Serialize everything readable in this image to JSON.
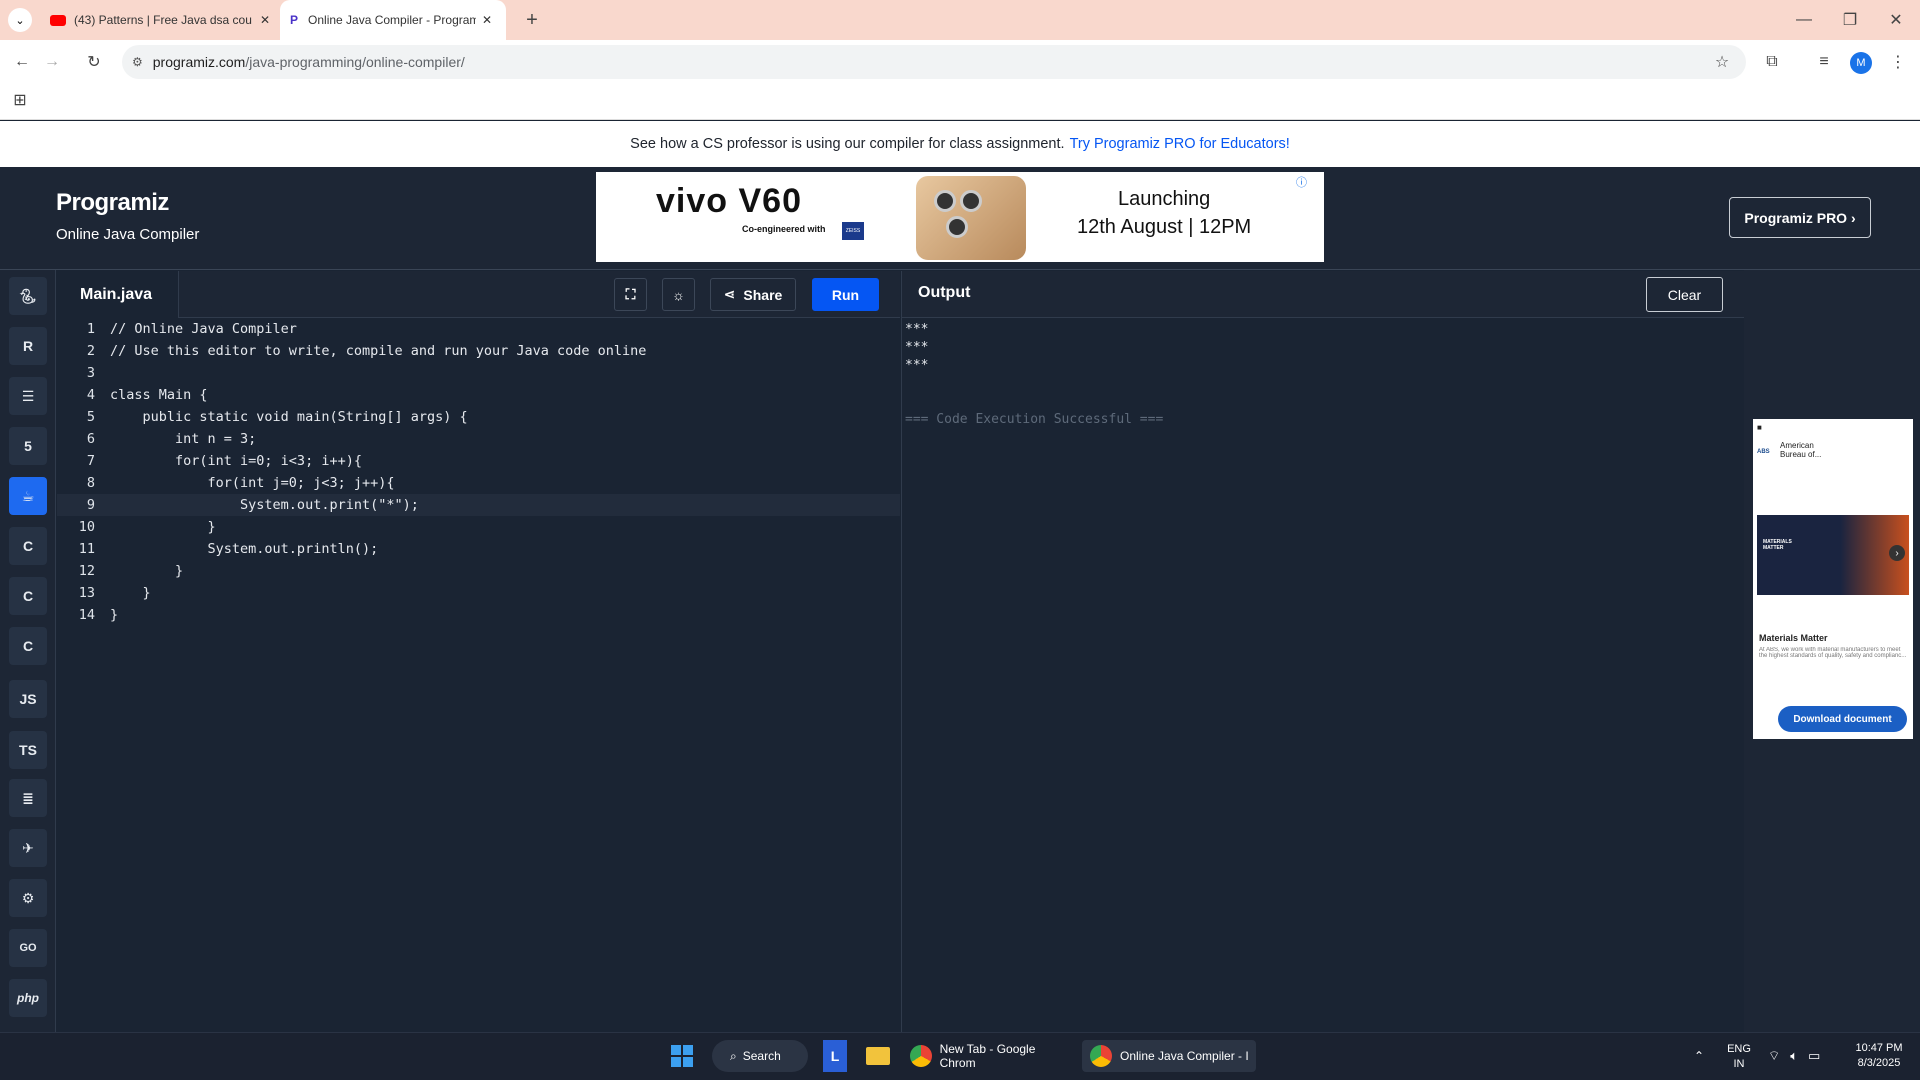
{
  "browser": {
    "tabs": [
      {
        "title": "(43) Patterns | Free Java dsa cou",
        "icon": "youtube-icon"
      },
      {
        "title": "Online Java Compiler - Program",
        "icon": "programiz-icon",
        "active": true
      }
    ],
    "url_host": "programiz.com",
    "url_path": "/java-programming/online-compiler/",
    "profile_initial": "M"
  },
  "promo": {
    "text": "See how a CS professor is using our compiler for class assignment.",
    "link": "Try Programiz PRO for Educators!"
  },
  "header": {
    "logo": "Programiz",
    "subtitle": "Online Java Compiler",
    "pro_button": "Programiz PRO ›"
  },
  "ad": {
    "brand": "vivo V60",
    "tagline": "Co-engineered with",
    "partner": "ZEISS",
    "headline": "Launching",
    "date_line": "12th August | 12PM"
  },
  "sidebar": {
    "languages": [
      "python",
      "r",
      "sql",
      "html",
      "java",
      "c",
      "cpp",
      "csharp",
      "JS",
      "TS",
      "go",
      "swift",
      "rust",
      "GO",
      "php"
    ]
  },
  "editor": {
    "file_name": "Main.java",
    "share_label": "Share",
    "run_label": "Run",
    "lines": [
      {
        "n": "1",
        "text": "// Online Java Compiler"
      },
      {
        "n": "2",
        "text": "// Use this editor to write, compile and run your Java code online"
      },
      {
        "n": "3",
        "text": ""
      },
      {
        "n": "4",
        "text": "class Main {"
      },
      {
        "n": "5",
        "text": "    public static void main(String[] args) {"
      },
      {
        "n": "6",
        "text": "        int n = 3;"
      },
      {
        "n": "7",
        "text": "        for(int i=0; i<3; i++){"
      },
      {
        "n": "8",
        "text": "            for(int j=0; j<3; j++){"
      },
      {
        "n": "9",
        "text": "                System.out.print(\"*\");"
      },
      {
        "n": "10",
        "text": "            }"
      },
      {
        "n": "11",
        "text": "            System.out.println();"
      },
      {
        "n": "12",
        "text": "        }"
      },
      {
        "n": "13",
        "text": "    }"
      },
      {
        "n": "14",
        "text": "}"
      }
    ]
  },
  "output": {
    "title": "Output",
    "clear_label": "Clear",
    "lines": [
      "***",
      "***",
      "***",
      "",
      "",
      "=== Code Execution Successful ==="
    ]
  },
  "side_ad": {
    "company": "American Bureau of...",
    "image_label": "MATERIALS MATTER",
    "title": "Materials Matter",
    "body": "At ABS, we work with material manufacturers to meet the highest standards of quality, safety and complianc...",
    "cta": "Download document"
  },
  "taskbar": {
    "search_label": "Search",
    "apps": [
      "New Tab - Google Chrom",
      "Online Java Compiler - I"
    ],
    "lang_top": "ENG",
    "lang_bottom": "IN",
    "time": "10:47 PM",
    "date": "8/3/2025"
  },
  "colors": {
    "accent": "#0556f3",
    "background": "#1a2433",
    "header": "#1d2635",
    "tabbar": "#f9d8cd"
  }
}
